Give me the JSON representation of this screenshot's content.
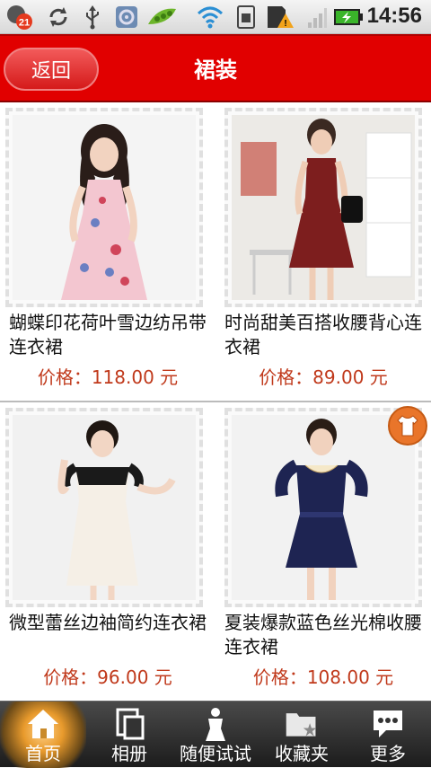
{
  "status_bar": {
    "time": "14:56",
    "notification_count": "21",
    "icons": [
      "notification-badge-icon",
      "sync-icon",
      "usb-icon",
      "settings-app-icon",
      "peapod-app-icon",
      "wifi-icon",
      "sim-icon",
      "sd-card-warning-icon",
      "signal-icon",
      "battery-charging-icon"
    ]
  },
  "header": {
    "back_label": "返回",
    "title": "裙装"
  },
  "products": [
    {
      "name": "蝴蝶印花荷叶雪边纺吊带连衣裙",
      "price": "价格：118.00 元",
      "dress_color": "#f3c6d0"
    },
    {
      "name": "时尚甜美百搭收腰背心连衣裙",
      "price": "价格：89.00 元",
      "dress_color": "#7d1e1e"
    },
    {
      "name": "微型蕾丝边袖简约连衣裙",
      "price": "价格：96.00 元",
      "dress_color": "#f5efe6"
    },
    {
      "name": "夏装爆款蓝色丝光棉收腰连衣裙",
      "price": "价格：108.00 元",
      "dress_color": "#1e2452"
    }
  ],
  "nav": {
    "items": [
      {
        "label": "首页",
        "icon": "home-icon",
        "active": true
      },
      {
        "label": "相册",
        "icon": "album-icon",
        "active": false
      },
      {
        "label": "随便试试",
        "icon": "mannequin-icon",
        "active": false
      },
      {
        "label": "收藏夹",
        "icon": "favorites-folder-icon",
        "active": false
      },
      {
        "label": "更多",
        "icon": "more-chat-icon",
        "active": false
      }
    ]
  },
  "colors": {
    "accent_red": "#e10000",
    "price_color": "#c0391b",
    "fab_orange": "#e9752a"
  }
}
